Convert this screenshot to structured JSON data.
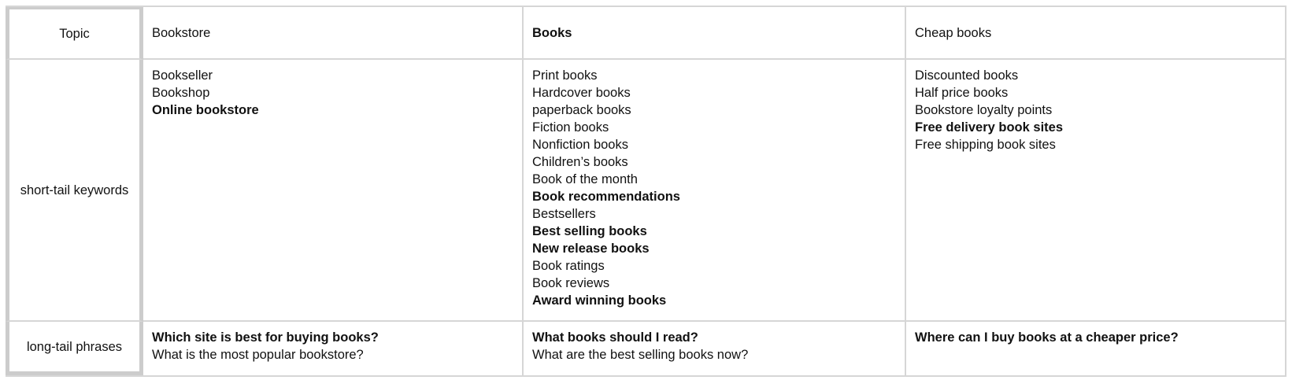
{
  "header": {
    "topic_label": "Topic",
    "columns": [
      {
        "label": "Bookstore",
        "bold": false
      },
      {
        "label": "Books",
        "bold": true
      },
      {
        "label": "Cheap books",
        "bold": false
      }
    ]
  },
  "rows": [
    {
      "label": "short-tail keywords",
      "cells": [
        [
          {
            "text": "Bookseller",
            "bold": false
          },
          {
            "text": "Bookshop",
            "bold": false
          },
          {
            "text": "Online bookstore",
            "bold": true
          }
        ],
        [
          {
            "text": "Print books",
            "bold": false
          },
          {
            "text": "Hardcover books",
            "bold": false
          },
          {
            "text": "paperback books",
            "bold": false
          },
          {
            "text": "Fiction books",
            "bold": false
          },
          {
            "text": "Nonfiction books",
            "bold": false
          },
          {
            "text": "Children’s books",
            "bold": false
          },
          {
            "text": "Book of the month",
            "bold": false
          },
          {
            "text": "Book recommendations",
            "bold": true
          },
          {
            "text": "Bestsellers",
            "bold": false
          },
          {
            "text": "Best selling books",
            "bold": true
          },
          {
            "text": "New release books",
            "bold": true
          },
          {
            "text": "Book ratings",
            "bold": false
          },
          {
            "text": "Book reviews",
            "bold": false
          },
          {
            "text": "Award winning books",
            "bold": true
          }
        ],
        [
          {
            "text": "Discounted books",
            "bold": false
          },
          {
            "text": "Half price books",
            "bold": false
          },
          {
            "text": "Bookstore loyalty points",
            "bold": false
          },
          {
            "text": "Free delivery book sites",
            "bold": true
          },
          {
            "text": "Free shipping book sites",
            "bold": false
          }
        ]
      ]
    },
    {
      "label": "long-tail phrases",
      "cells": [
        [
          {
            "text": "Which site is best for buying books?",
            "bold": true
          },
          {
            "text": "What is the most popular bookstore?",
            "bold": false
          }
        ],
        [
          {
            "text": "What books should I read?",
            "bold": true
          },
          {
            "text": "What are the best selling books now?",
            "bold": false
          }
        ],
        [
          {
            "text": "Where can I buy books at a cheaper price?",
            "bold": true
          }
        ]
      ]
    }
  ]
}
